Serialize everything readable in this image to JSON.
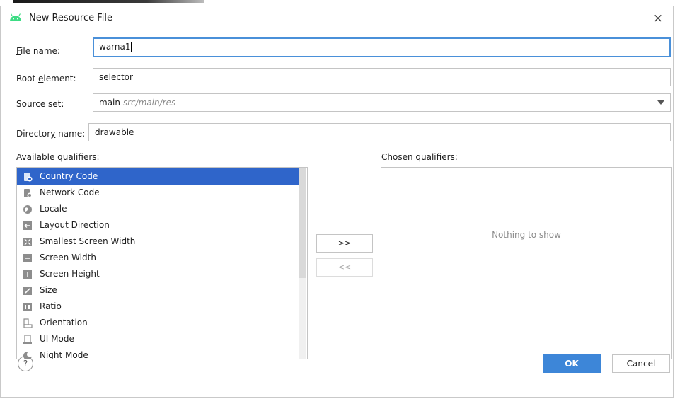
{
  "dialog": {
    "title": "New Resource File",
    "close_glyph": "×"
  },
  "form": {
    "file_name": {
      "label_key": "F",
      "label_rest": "ile name:",
      "value": "warna1"
    },
    "root_element": {
      "label_pre": "Root ",
      "label_key": "e",
      "label_rest": "lement:",
      "value": "selector"
    },
    "source_set": {
      "label_key": "S",
      "label_rest": "ource set:",
      "value": "main",
      "path": "src/main/res"
    },
    "directory_name": {
      "label_pre": "Director",
      "label_key": "y",
      "label_rest": " name:",
      "value": "drawable"
    }
  },
  "qualifiers": {
    "available_label_pre": "A",
    "available_label_key": "v",
    "available_label_rest": "ailable qualifiers:",
    "chosen_label_pre": "C",
    "chosen_label_key": "h",
    "chosen_label_rest": "osen qualifiers:",
    "items": [
      {
        "label": "Country Code",
        "icon": "country-code-icon",
        "selected": true
      },
      {
        "label": "Network Code",
        "icon": "network-code-icon"
      },
      {
        "label": "Locale",
        "icon": "globe-icon"
      },
      {
        "label": "Layout Direction",
        "icon": "layout-direction-icon"
      },
      {
        "label": "Smallest Screen Width",
        "icon": "smallest-width-icon"
      },
      {
        "label": "Screen Width",
        "icon": "screen-width-icon"
      },
      {
        "label": "Screen Height",
        "icon": "screen-height-icon"
      },
      {
        "label": "Size",
        "icon": "size-icon"
      },
      {
        "label": "Ratio",
        "icon": "ratio-icon"
      },
      {
        "label": "Orientation",
        "icon": "orientation-icon"
      },
      {
        "label": "UI Mode",
        "icon": "ui-mode-icon"
      },
      {
        "label": "Night Mode",
        "icon": "night-mode-icon"
      }
    ],
    "add_button": ">>",
    "remove_button": "<<",
    "empty_text": "Nothing to show"
  },
  "footer": {
    "help": "?",
    "ok": "OK",
    "cancel": "Cancel"
  },
  "colors": {
    "selection": "#2f65ca",
    "ok_button": "#3d86d8",
    "android_green": "#3ddc84",
    "focus_border": "#4a90d9"
  }
}
